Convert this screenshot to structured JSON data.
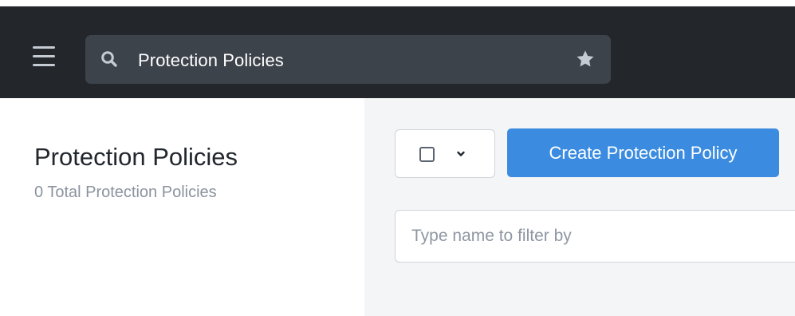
{
  "header": {
    "search": {
      "value": "Protection Policies"
    }
  },
  "main": {
    "title": "Protection Policies",
    "subtitle": "0 Total Protection Policies",
    "create_button_label": "Create Protection Policy",
    "filter_placeholder": "Type name to filter by",
    "filter_value": ""
  },
  "icons": {
    "menu": "hamburger-icon",
    "search": "search-icon",
    "favorite": "star-icon",
    "select_all": "checkbox-icon",
    "dropdown": "chevron-down-icon"
  },
  "colors": {
    "topbar": "#23262b",
    "search_bg": "#3d434b",
    "accent": "#3b8ce0",
    "panel_bg": "#f4f5f7"
  }
}
